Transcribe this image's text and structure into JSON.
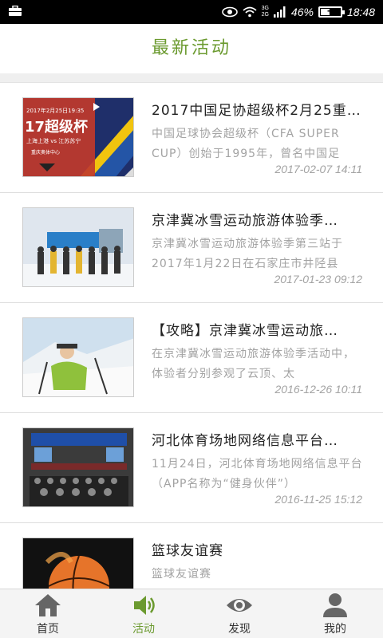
{
  "status_bar": {
    "network_2g": "2G",
    "network_3g": "3G",
    "battery_percent": "46%",
    "battery_level": 0.46,
    "time": "18:48"
  },
  "header": {
    "title": "最新活动"
  },
  "list": [
    {
      "title": "2017中国足协超级杯2月25重…",
      "summary": "中国足球协会超级杯（CFA SUPER CUP）创始于1995年，曾名中国足",
      "date": "2017-02-07 14:11",
      "thumb": {
        "big_text": "17超级杯",
        "date_text": "2017年2月25日19:35",
        "teams": "上海上港 vs 江苏苏宁",
        "venue": "重庆奥体中心"
      }
    },
    {
      "title": "京津冀冰雪运动旅游体验季…",
      "summary": "京津冀冰雪运动旅游体验季第三站于2017年1月22日在石家庄市井陉县",
      "date": "2017-01-23 09:12"
    },
    {
      "title": "【攻略】京津冀冰雪运动旅…",
      "summary": "在京津冀冰雪运动旅游体验季活动中，体验者分别参观了云顶、太",
      "date": "2016-12-26 10:11"
    },
    {
      "title": "河北体育场地网络信息平台…",
      "summary": "11月24日，河北体育场地网络信息平台（APP名称为“健身伙伴”）",
      "date": "2016-11-25 15:12"
    },
    {
      "title": "篮球友谊赛",
      "summary": "篮球友谊赛",
      "date": ""
    }
  ],
  "bottom_nav": [
    {
      "label": "首页",
      "icon": "home-icon"
    },
    {
      "label": "活动",
      "icon": "speaker-icon",
      "active": true
    },
    {
      "label": "发现",
      "icon": "eye-icon"
    },
    {
      "label": "我的",
      "icon": "person-icon"
    }
  ],
  "colors": {
    "accent": "#6b9a2f",
    "status_bar": "#000000",
    "separator": "#efefef"
  }
}
